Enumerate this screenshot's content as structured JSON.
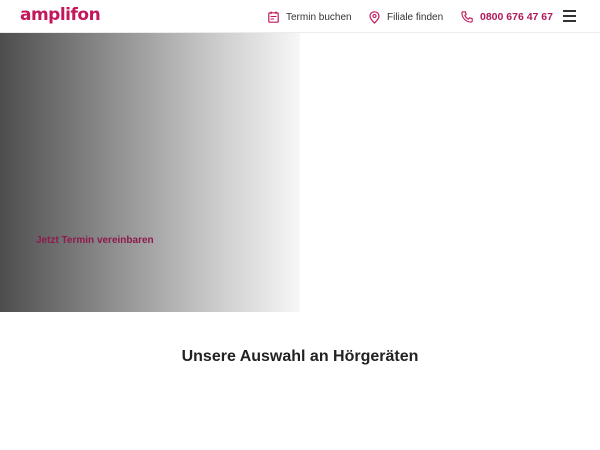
{
  "header": {
    "logo_text": "amplifon",
    "nav": {
      "appointment_label": "Termin buchen",
      "store_label": "Filiale finden",
      "phone_label": "0800 676 47 67"
    },
    "icons": {
      "appointment": "calendar-icon",
      "store": "location-pin-icon",
      "phone": "phone-icon",
      "menu": "hamburger-menu-icon"
    }
  },
  "hero": {
    "cta_label": "Jetzt Termin vereinbaren"
  },
  "section": {
    "title": "Unsere Auswahl an Hörgeräten"
  },
  "colors": {
    "brand": "#c2185b",
    "phone_text": "#b0185a",
    "cta_text": "#8e1a4e"
  }
}
